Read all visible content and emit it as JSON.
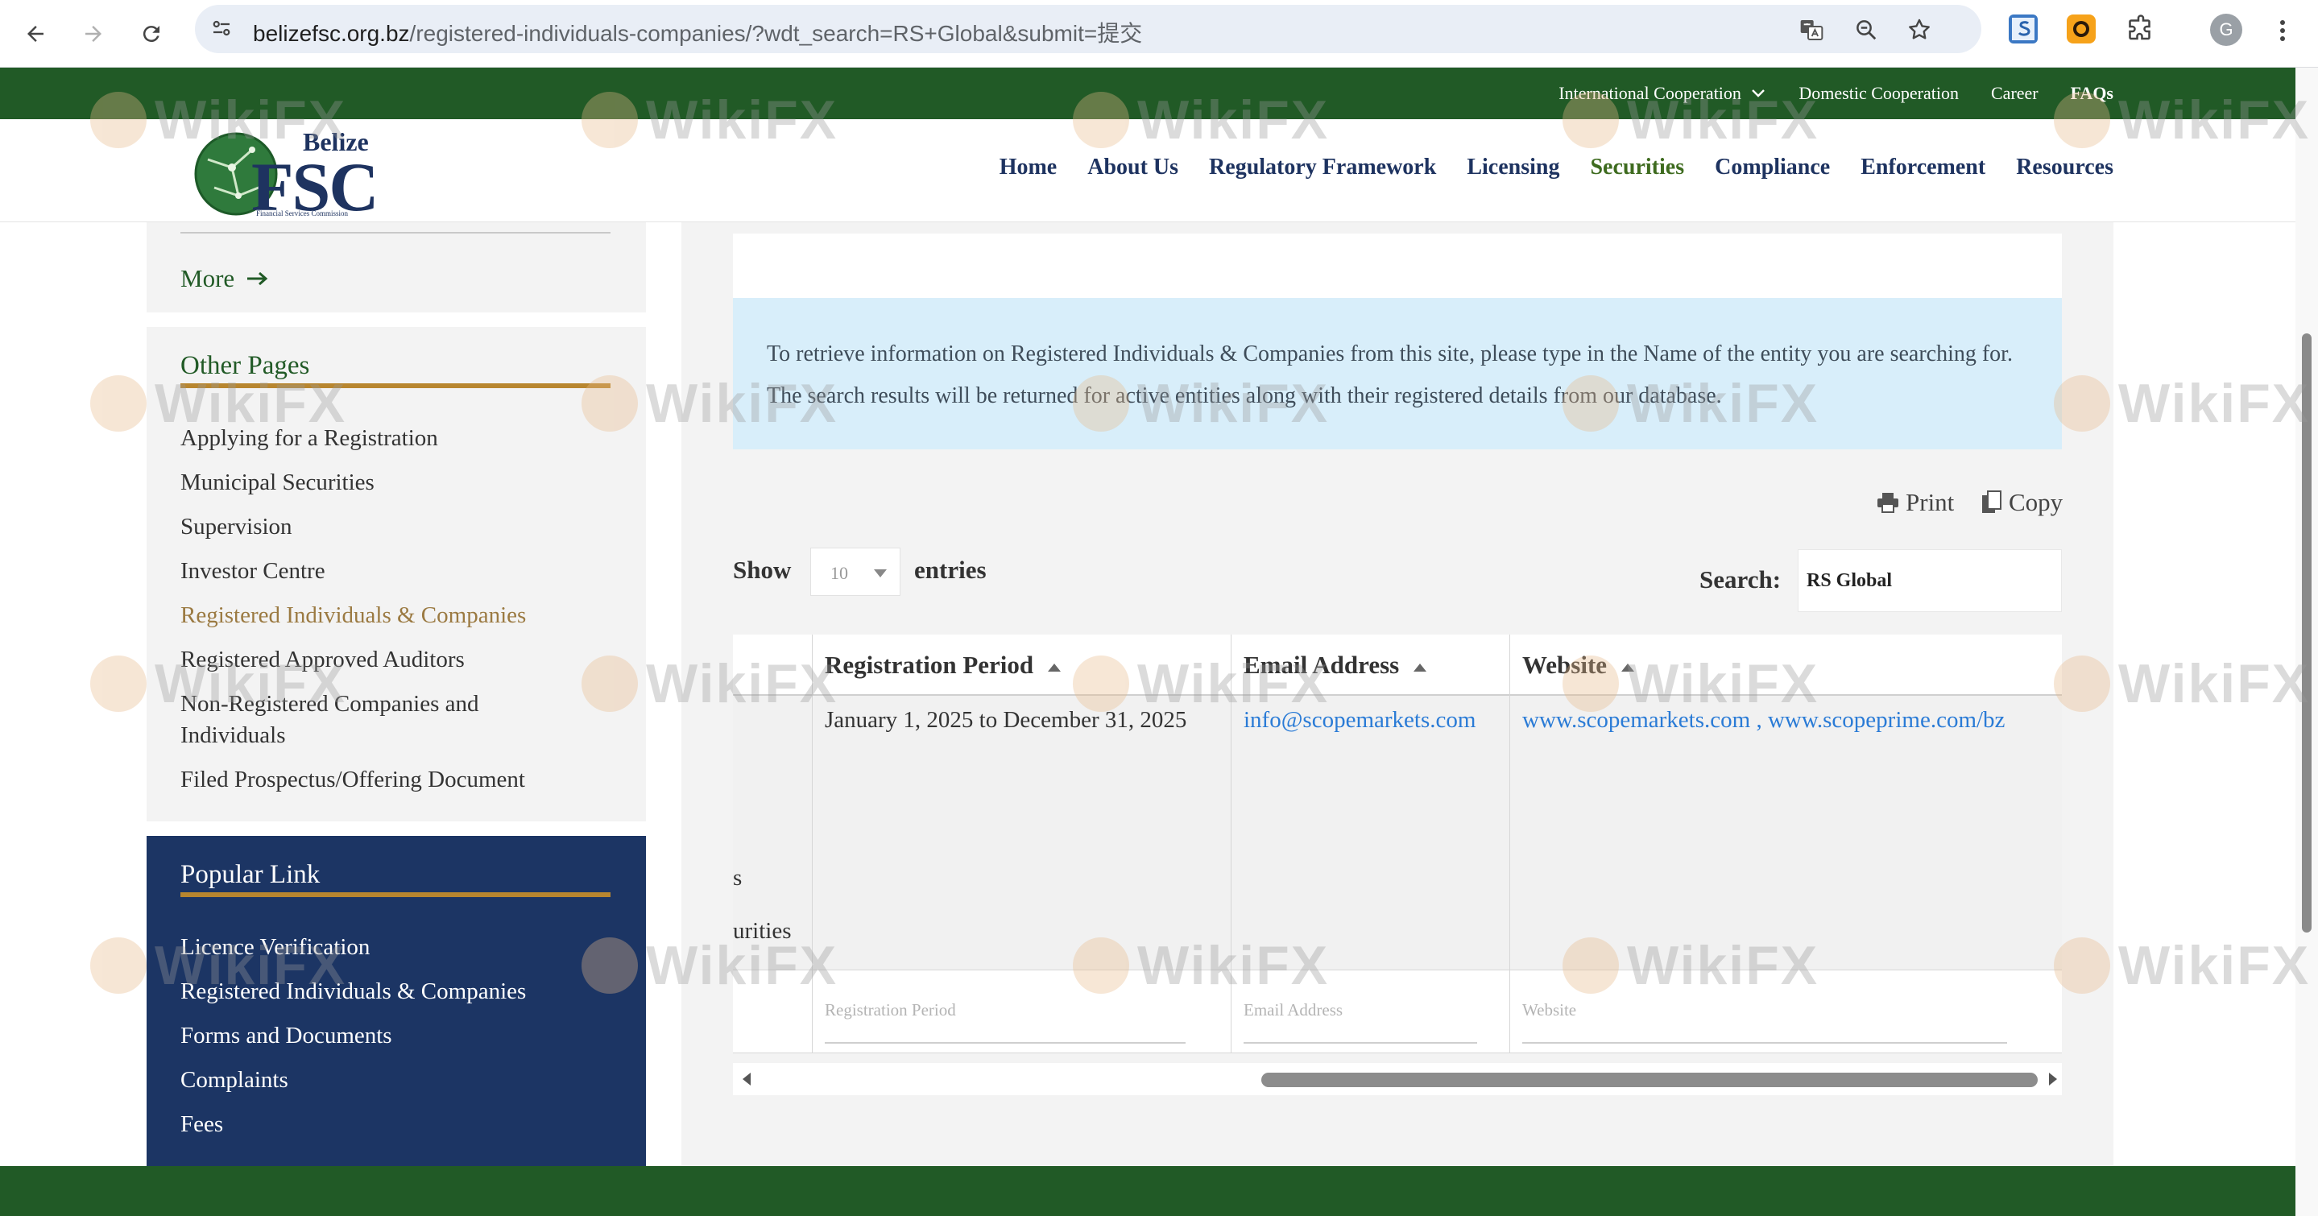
{
  "browser": {
    "url_host": "belizefsc.org.bz",
    "url_path": "/registered-individuals-companies/?wdt_search=RS+Global&submit=提交",
    "avatar_letter": "G"
  },
  "topbar": {
    "links": [
      "International Cooperation",
      "Domestic Cooperation",
      "Career",
      "FAQs"
    ]
  },
  "logo": {
    "word1": "Belize",
    "word2": "FSC",
    "tagline": "Financial Services Commission"
  },
  "mainnav": {
    "items": [
      "Home",
      "About Us",
      "Regulatory Framework",
      "Licensing",
      "Securities",
      "Compliance",
      "Enforcement",
      "Resources"
    ],
    "active": "Securities"
  },
  "sidebar": {
    "more_label": "More",
    "other_pages_title": "Other Pages",
    "other_pages": [
      "Applying for a Registration",
      "Municipal Securities",
      "Supervision",
      "Investor Centre",
      "Registered Individuals & Companies",
      "Registered Approved Auditors",
      "Non-Registered Companies and",
      "Individuals",
      "Filed Prospectus/Offering Document"
    ],
    "popular_title": "Popular Link",
    "popular_links": [
      "Licence Verification",
      "Registered Individuals & Companies",
      "Forms and Documents",
      "Complaints",
      "Fees"
    ]
  },
  "main": {
    "info_text": "To retrieve information on Registered Individuals & Companies from this site, please type in the Name of the entity you are searching for. The search results will be returned for active entities along with their registered details from our database.",
    "print_label": "Print",
    "copy_label": "Copy",
    "show_label": "Show",
    "entries_label": "entries",
    "page_size": "10",
    "search_label": "Search:",
    "search_value": "RS Global"
  },
  "table": {
    "headers": [
      "Registration Period",
      "Email Address",
      "Website"
    ],
    "row": {
      "period": "January 1, 2025 to December 31, 2025",
      "email": "info@scopemarkets.com",
      "website": "www.scopemarkets.com , www.scopeprime.com/bz"
    },
    "clipped_text_1": "s",
    "clipped_text_2": "urities",
    "filters": [
      "Registration Period",
      "Email Address",
      "Website"
    ]
  },
  "watermark": {
    "text": "WikiFX"
  },
  "colors": {
    "green": "#215a26",
    "navy": "#1c3564",
    "gold": "#b8862f",
    "link": "#2a7bd6",
    "info_bg": "#d8eefa"
  }
}
